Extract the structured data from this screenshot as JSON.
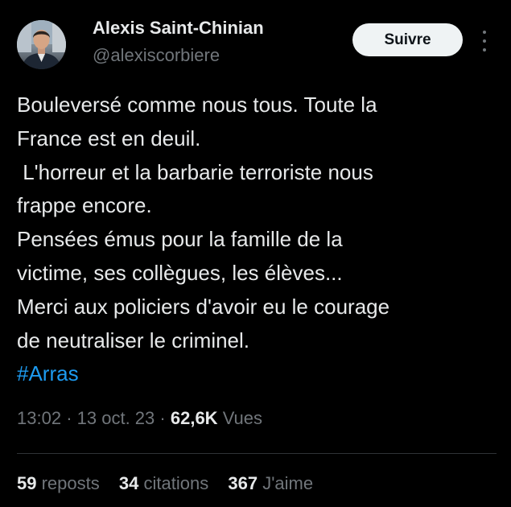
{
  "author": {
    "name": "Alexis Saint-Chinian",
    "handle": "@alexiscorbiere",
    "follow_label": "Suivre"
  },
  "tweet": {
    "lines": [
      "Bouleversé comme nous tous. Toute la",
      "France est en deuil.",
      " L'horreur et la barbarie terroriste nous",
      "frappe encore.",
      "Pensées émus pour la famille de la",
      "victime, ses collègues, les élèves...",
      "Merci aux policiers d'avoir eu le courage",
      "de neutraliser le criminel."
    ],
    "hashtag": "#Arras"
  },
  "meta": {
    "time": "13:02",
    "separator": "·",
    "date": "13 oct. 23",
    "views_count": "62,6K",
    "views_label": "Vues"
  },
  "stats": {
    "reposts_count": "59",
    "reposts_label": "reposts",
    "quotes_count": "34",
    "quotes_label": "citations",
    "likes_count": "367",
    "likes_label": "J'aime"
  },
  "colors": {
    "background": "#000000",
    "text": "#e7e9ea",
    "secondary": "#71767b",
    "link": "#1d9bf0",
    "button_bg": "#eff3f4"
  },
  "icons": {
    "more": "more-dots-vertical-icon",
    "avatar": "profile-photo"
  }
}
